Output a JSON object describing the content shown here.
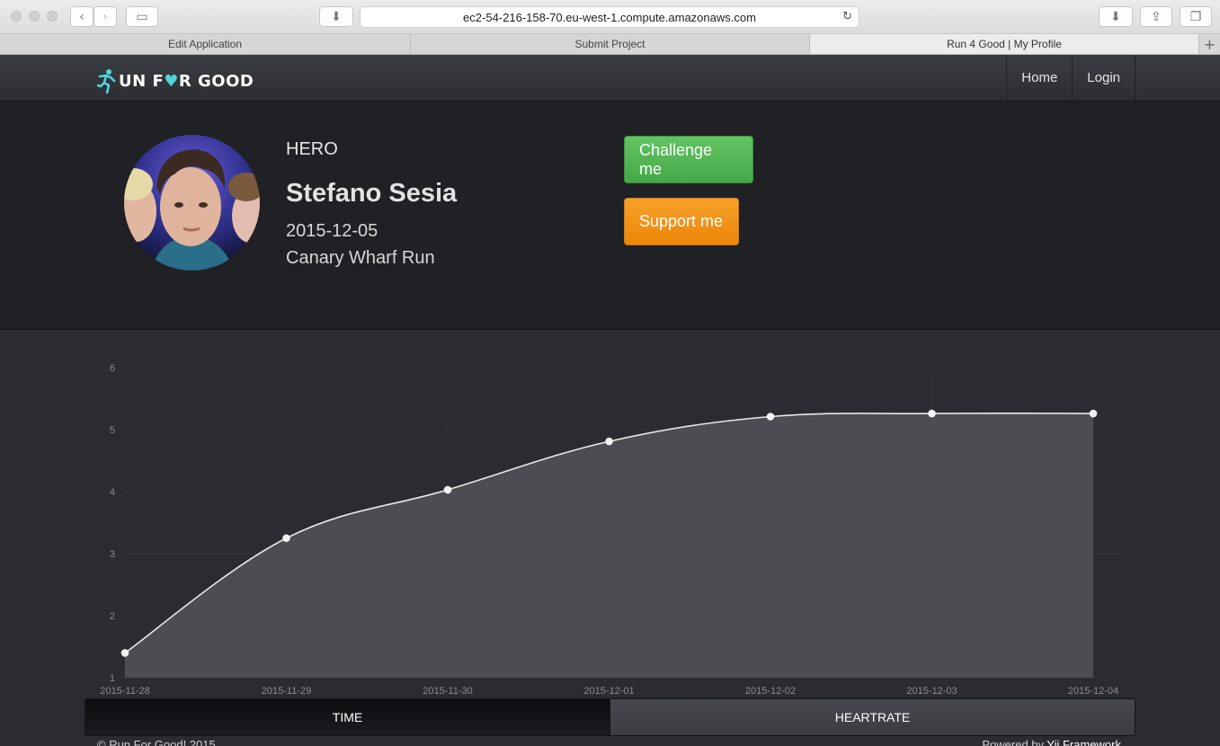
{
  "browser": {
    "url": "ec2-54-216-158-70.eu-west-1.compute.amazonaws.com",
    "tabs": [
      {
        "label": "Edit Application"
      },
      {
        "label": "Submit Project"
      },
      {
        "label": "Run 4 Good | My Profile"
      }
    ],
    "new_tab": "+"
  },
  "site": {
    "logo": {
      "prefix": "UN F",
      "heart": "♥",
      "suffix": "R GOOD"
    },
    "nav": [
      {
        "label": "Home"
      },
      {
        "label": "Login"
      }
    ]
  },
  "profile": {
    "role": "HERO",
    "name": "Stefano Sesia",
    "date": "2015-12-05",
    "event": "Canary Wharf Run",
    "challenge_label": "Challenge me",
    "support_label": "Support me"
  },
  "chart_data": {
    "type": "area",
    "x": [
      "2015-11-28",
      "2015-11-29",
      "2015-11-30",
      "2015-12-01",
      "2015-12-02",
      "2015-12-03",
      "2015-12-04"
    ],
    "values": [
      1.4,
      3.25,
      4.03,
      4.81,
      5.21,
      5.26,
      5.26
    ],
    "ylim": [
      1,
      6
    ],
    "yticks": [
      "1",
      "2",
      "3",
      "4",
      "5",
      "6"
    ],
    "grid": true,
    "colors": {
      "line": "#e8e8e8",
      "fill": "#4b4d52",
      "point": "#f2f2f2"
    }
  },
  "switcher": {
    "time_label": "TIME",
    "heartrate_label": "HEARTRATE"
  },
  "footer": {
    "copyright": "© Run For Good! 2015",
    "powered_prefix": "Powered by ",
    "powered_link": "Yii Framework"
  },
  "icons": [
    "back-icon",
    "forward-icon",
    "sidebar-icon",
    "download-icon",
    "reload-icon",
    "share-icon",
    "tabs-icon",
    "runner-logo-icon"
  ]
}
